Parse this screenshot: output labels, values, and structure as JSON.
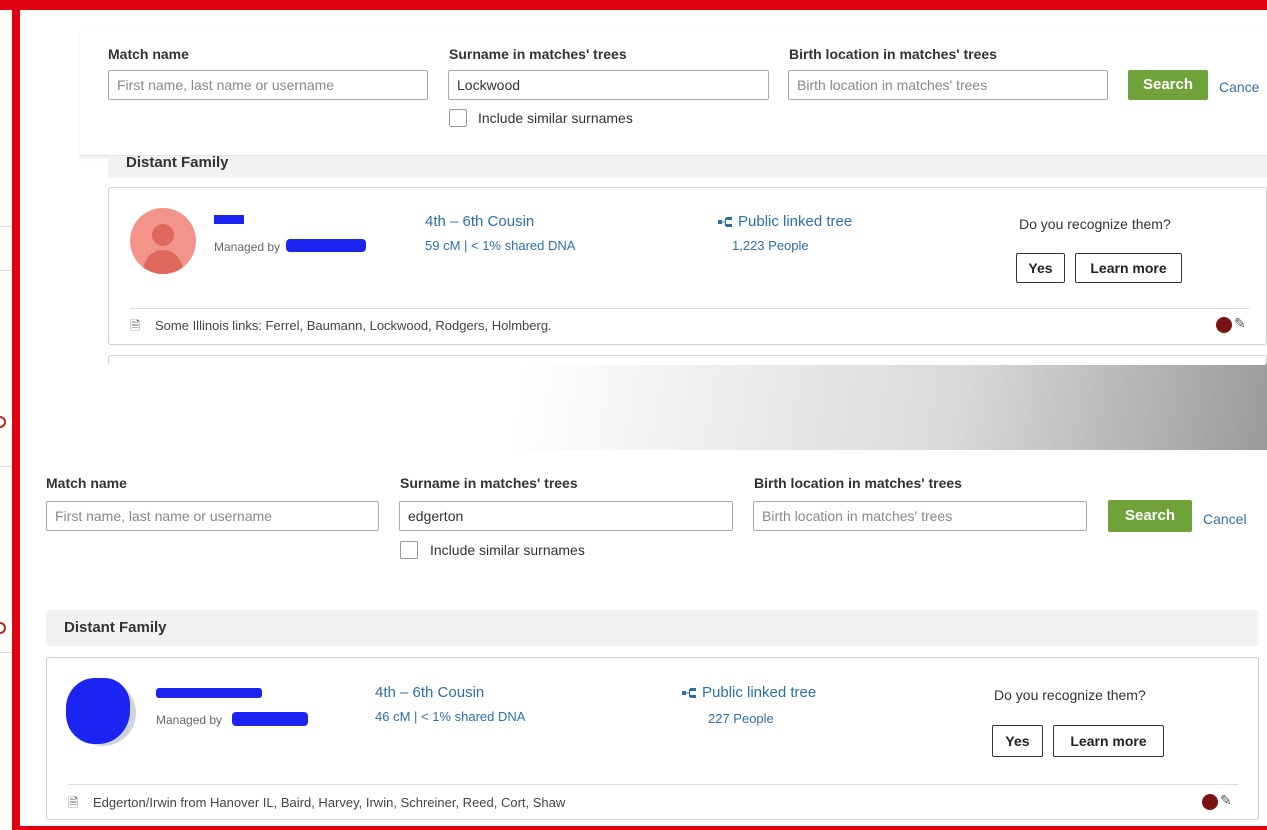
{
  "screenshot_top": {
    "filters": {
      "match_name": {
        "label": "Match name",
        "placeholder": "First name, last name or username"
      },
      "surname": {
        "label": "Surname in matches' trees",
        "value": "Lockwood"
      },
      "birth_location": {
        "label": "Birth location in matches' trees",
        "placeholder": "Birth location in matches' trees"
      },
      "include_similar_label": "Include similar surnames",
      "search_label": "Search",
      "cancel_label": "Cance"
    },
    "section_title": "Distant Family",
    "match": {
      "managed_by": "Managed by",
      "relationship": "4th – 6th Cousin",
      "dna": "59 cM | < 1% shared DNA",
      "tree_label": "Public linked tree",
      "tree_people": "1,223 People",
      "recognize_prompt": "Do you recognize them?",
      "yes_label": "Yes",
      "learn_more_label": "Learn more",
      "note": "Some Illinois links: Ferrel, Baumann, Lockwood, Rodgers, Holmberg."
    }
  },
  "screenshot_bottom": {
    "filters": {
      "match_name": {
        "label": "Match name",
        "placeholder": "First name, last name or username"
      },
      "surname": {
        "label": "Surname in matches' trees",
        "value": "edgerton"
      },
      "birth_location": {
        "label": "Birth location in matches' trees",
        "placeholder": "Birth location in matches' trees"
      },
      "include_similar_label": "Include similar surnames",
      "search_label": "Search",
      "cancel_label": "Cancel"
    },
    "section_title": "Distant Family",
    "match": {
      "managed_by": "Managed by",
      "relationship": "4th – 6th Cousin",
      "dna": "46 cM | < 1% shared DNA",
      "tree_label": "Public linked tree",
      "tree_people": "227 People",
      "recognize_prompt": "Do you recognize them?",
      "yes_label": "Yes",
      "learn_more_label": "Learn more",
      "note": "Edgerton/Irwin from Hanover IL, Baird, Harvey, Irwin, Schreiner, Reed, Cort, Shaw"
    }
  },
  "colors": {
    "frame_red": "#e0000f",
    "search_green": "#6fa33a",
    "link_blue": "#2f6fa8",
    "redaction_blue": "#1b24f0",
    "avatar_pink": "#f3948a",
    "dot_maroon": "#7a1414"
  },
  "icons": [
    "tree-icon",
    "note-icon",
    "pencil-icon",
    "avatar-placeholder-icon"
  ]
}
